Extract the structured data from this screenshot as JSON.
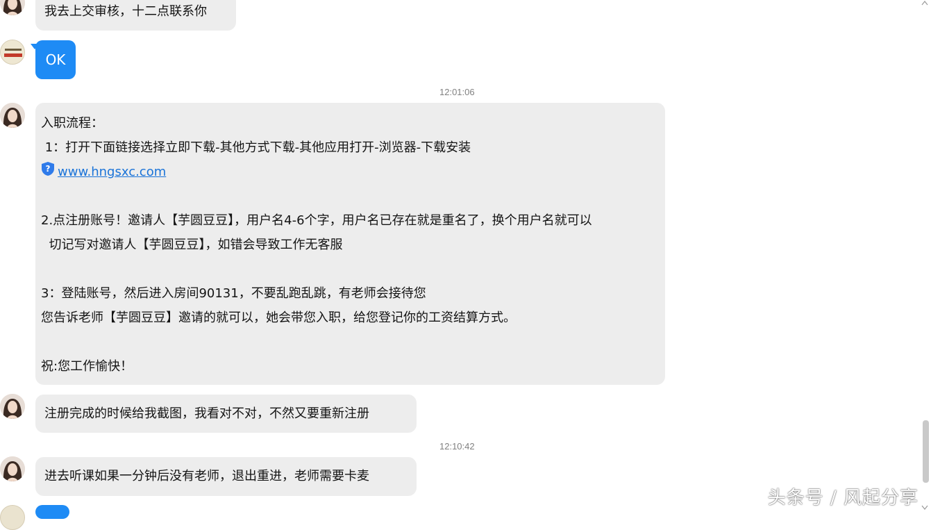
{
  "messages": [
    {
      "text": "我去上交审核，十二点联系你"
    },
    {
      "text": "OK"
    },
    {
      "text": "注册完成的时候给我截图，我看对不对，不然又要重新注册"
    },
    {
      "text": "进去听课如果一分钟后没有老师，退出重进，老师需要卡麦"
    }
  ],
  "timestamps": [
    "12:01:06",
    "12:10:42"
  ],
  "onboarding": {
    "line1": "入职流程：",
    "line2": " 1：打开下面链接选择立即下载-其他方式下载-其他应用打开-浏览器-下载安装",
    "link": "www.hngsxc.com",
    "line3": "2.点注册账号！邀请人【芋圆豆豆】，用户名4-6个字，用户名已存在就是重名了，换个用户名就可以",
    "line4": "  切记写对邀请人【芋圆豆豆】，如错会导致工作无客服",
    "line5": "3：登陆账号，然后进入房间90131，不要乱跑乱跳，有老师会接待您",
    "line6": "您告诉老师【芋圆豆豆】邀请的就可以，她会带您入职，给您登记你的工资结算方式。",
    "line7": "祝:您工作愉快！"
  },
  "icons": {
    "avatar_girl": "girl-portrait-icon",
    "avatar_logo": "logo-avatar-icon",
    "link_shield": "shield-question-icon",
    "scroll_up": "scroll-up-arrow-icon",
    "scroll_down": "scroll-down-arrow-icon"
  },
  "watermark": "头条号 / 风起分享",
  "colors": {
    "received_bubble": "#ededed",
    "sent_bubble": "#1e8bf5",
    "link": "#1a73d8",
    "timestamp": "#808080"
  }
}
